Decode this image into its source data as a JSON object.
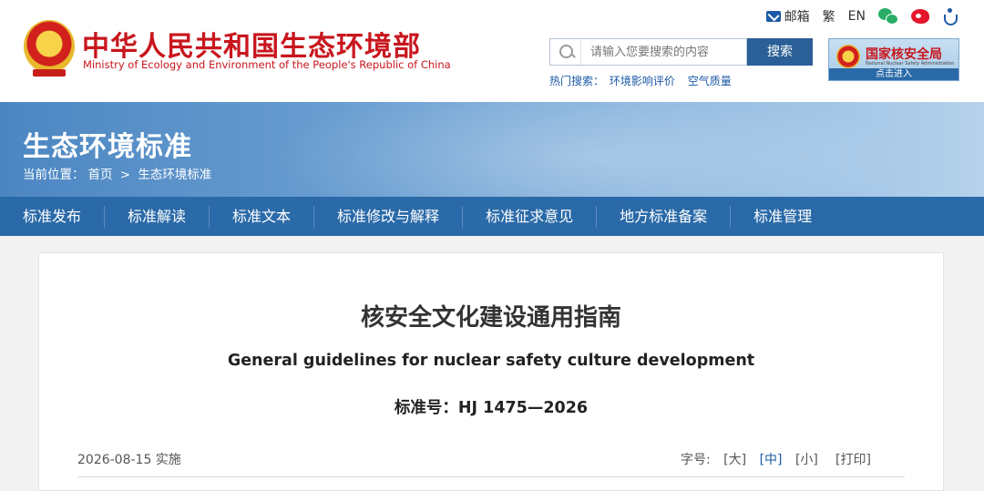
{
  "header": {
    "site_title": "中华人民共和国生态环境部",
    "site_subtitle": "Ministry of Ecology and Environment of the People's Republic of China",
    "emblem_icon": "national-emblem-icon"
  },
  "top_links": {
    "mail": "邮箱",
    "traditional": "繁",
    "english": "EN"
  },
  "search": {
    "placeholder": "请输入您要搜索的内容",
    "button": "搜索",
    "hot_label": "热门搜索：",
    "hot_items": [
      "环境影响评价",
      "空气质量"
    ]
  },
  "nnsa": {
    "title": "国家核安全局",
    "subtitle": "National Nuclear Safety Administration",
    "enter": "点击进入"
  },
  "banner": {
    "title": "生态环境标准",
    "breadcrumb_label": "当前位置：",
    "breadcrumb_home": "首页",
    "breadcrumb_sep": ">",
    "breadcrumb_current": "生态环境标准"
  },
  "nav": {
    "items": [
      "标准发布",
      "标准解读",
      "标准文本",
      "标准修改与解释",
      "标准征求意见",
      "地方标准备案",
      "标准管理"
    ]
  },
  "document": {
    "title": "核安全文化建设通用指南",
    "title_en": "General guidelines for nuclear safety culture development",
    "standard_no": "标准号：HJ 1475—2026",
    "effective": "2026-08-15 实施",
    "font_label": "字号:",
    "font_large": "[大]",
    "font_medium": "[中]",
    "font_small": "[小]",
    "print": "[打印]"
  },
  "colors": {
    "brand_red": "#c8161d",
    "nav_blue": "#2b6aa8",
    "link_blue": "#1d5aa6"
  }
}
